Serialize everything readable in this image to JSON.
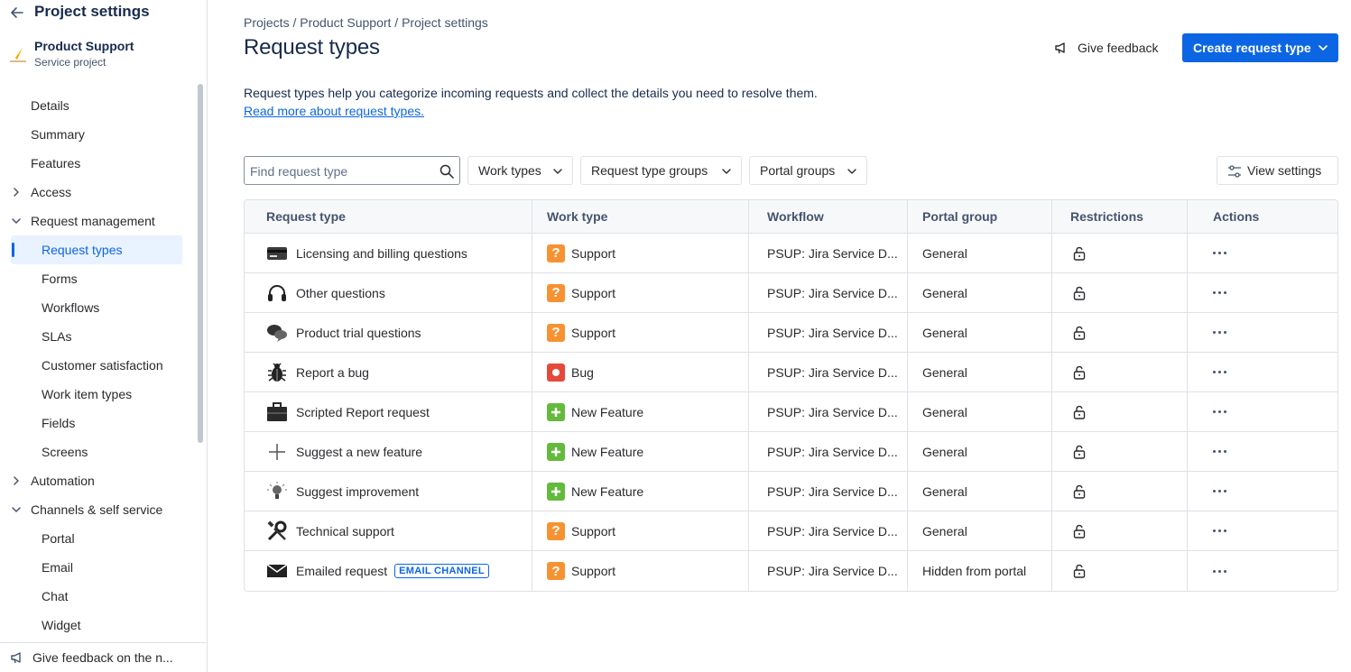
{
  "sidebar": {
    "title": "Project settings",
    "project_name": "Product Support",
    "project_type": "Service project",
    "items": [
      {
        "label": "Details"
      },
      {
        "label": "Summary"
      },
      {
        "label": "Features"
      },
      {
        "label": "Access"
      },
      {
        "label": "Request management"
      },
      {
        "label": "Request types"
      },
      {
        "label": "Forms"
      },
      {
        "label": "Workflows"
      },
      {
        "label": "SLAs"
      },
      {
        "label": "Customer satisfaction"
      },
      {
        "label": "Work item types"
      },
      {
        "label": "Fields"
      },
      {
        "label": "Screens"
      },
      {
        "label": "Automation"
      },
      {
        "label": "Channels & self service"
      },
      {
        "label": "Portal"
      },
      {
        "label": "Email"
      },
      {
        "label": "Chat"
      },
      {
        "label": "Widget"
      }
    ],
    "footer_label": "Give feedback on the n..."
  },
  "breadcrumb": [
    "Projects",
    "Product Support",
    "Project settings"
  ],
  "breadcrumb_sep": " / ",
  "page_title": "Request types",
  "give_feedback_label": "Give feedback",
  "create_button_label": "Create request type",
  "description": "Request types help you categorize incoming requests and collect the details you need to resolve them.",
  "description_link": "Read more about request types.",
  "search": {
    "placeholder": "Find request type",
    "value": ""
  },
  "filters": [
    "Work types",
    "Request type groups",
    "Portal groups"
  ],
  "view_settings_label": "View settings",
  "table": {
    "headers": [
      "Request type",
      "Work type",
      "Workflow",
      "Portal group",
      "Restrictions",
      "Actions"
    ],
    "rows": [
      {
        "name": "Licensing and billing questions",
        "icon": "credit-card-icon",
        "work_type": "Support",
        "work_icon": "question-icon",
        "workflow": "PSUP: Jira Service D...",
        "portal_group": "General"
      },
      {
        "name": "Other questions",
        "icon": "headset-icon",
        "work_type": "Support",
        "work_icon": "question-icon",
        "workflow": "PSUP: Jira Service D...",
        "portal_group": "General"
      },
      {
        "name": "Product trial questions",
        "icon": "chat-bubbles-icon",
        "work_type": "Support",
        "work_icon": "question-icon",
        "workflow": "PSUP: Jira Service D...",
        "portal_group": "General"
      },
      {
        "name": "Report a bug",
        "icon": "bug-icon",
        "work_type": "Bug",
        "work_icon": "bug-dot-icon",
        "workflow": "PSUP: Jira Service D...",
        "portal_group": "General"
      },
      {
        "name": "Scripted Report request",
        "icon": "briefcase-icon",
        "work_type": "New Feature",
        "work_icon": "plus-icon",
        "workflow": "PSUP: Jira Service D...",
        "portal_group": "General"
      },
      {
        "name": "Suggest a new feature",
        "icon": "add-icon",
        "work_type": "New Feature",
        "work_icon": "plus-icon",
        "workflow": "PSUP: Jira Service D...",
        "portal_group": "General"
      },
      {
        "name": "Suggest improvement",
        "icon": "lightbulb-icon",
        "work_type": "New Feature",
        "work_icon": "plus-icon",
        "workflow": "PSUP: Jira Service D...",
        "portal_group": "General"
      },
      {
        "name": "Technical support",
        "icon": "tools-icon",
        "work_type": "Support",
        "work_icon": "question-icon",
        "workflow": "PSUP: Jira Service D...",
        "portal_group": "General"
      },
      {
        "name": "Emailed request",
        "icon": "envelope-icon",
        "badge": "EMAIL CHANNEL",
        "work_type": "Support",
        "work_icon": "question-icon",
        "workflow": "PSUP: Jira Service D...",
        "portal_group": "Hidden from portal"
      }
    ]
  },
  "colors": {
    "primary": "#0c66e4",
    "support": "#f79232",
    "bug": "#e5493a",
    "new_feature": "#63ba3c"
  }
}
